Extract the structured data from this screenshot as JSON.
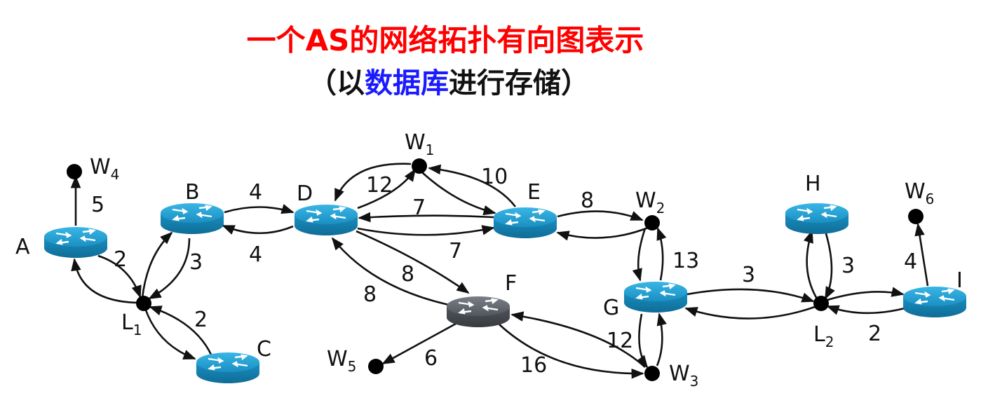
{
  "title": {
    "line1": "一个AS的网络拓扑有向图表示",
    "line2_prefix": "（以",
    "line2_highlight": "数据库",
    "line2_suffix": "进行存储）"
  },
  "colors": {
    "title": "#ff0000",
    "highlight": "#1a1aff",
    "router": "#1f9fd3",
    "router_gray": "#5b5f66"
  },
  "routers": [
    "A",
    "B",
    "D",
    "E",
    "F",
    "G",
    "H",
    "I"
  ],
  "hubs": [
    {
      "name": "L",
      "sub": "1"
    },
    {
      "name": "L",
      "sub": "2"
    },
    {
      "name": "C",
      "sub": ""
    }
  ],
  "hosts": [
    {
      "name": "W",
      "sub": "1"
    },
    {
      "name": "W",
      "sub": "2"
    },
    {
      "name": "W",
      "sub": "3"
    },
    {
      "name": "W",
      "sub": "4"
    },
    {
      "name": "W",
      "sub": "5"
    },
    {
      "name": "W",
      "sub": "6"
    }
  ],
  "edges": [
    {
      "from": "A",
      "to": "W4",
      "weight": "5"
    },
    {
      "from": "A",
      "to": "L1",
      "weight": "2"
    },
    {
      "from": "L1",
      "to": "A",
      "weight": ""
    },
    {
      "from": "B",
      "to": "L1",
      "weight": "3"
    },
    {
      "from": "L1",
      "to": "B",
      "weight": ""
    },
    {
      "from": "C",
      "to": "L1",
      "weight": "2"
    },
    {
      "from": "L1",
      "to": "C",
      "weight": ""
    },
    {
      "from": "B",
      "to": "D",
      "weight": "4"
    },
    {
      "from": "D",
      "to": "B",
      "weight": "4"
    },
    {
      "from": "D",
      "to": "W1",
      "weight": "12"
    },
    {
      "from": "W1",
      "to": "D",
      "weight": ""
    },
    {
      "from": "E",
      "to": "W1",
      "weight": "10"
    },
    {
      "from": "W1",
      "to": "E",
      "weight": ""
    },
    {
      "from": "E",
      "to": "D",
      "weight": "7"
    },
    {
      "from": "D",
      "to": "E",
      "weight": "7"
    },
    {
      "from": "E",
      "to": "W2",
      "weight": "8"
    },
    {
      "from": "W2",
      "to": "E",
      "weight": ""
    },
    {
      "from": "D",
      "to": "F",
      "weight": "8"
    },
    {
      "from": "F",
      "to": "D",
      "weight": "8"
    },
    {
      "from": "F",
      "to": "W5",
      "weight": "6"
    },
    {
      "from": "F",
      "to": "W3",
      "weight": "16"
    },
    {
      "from": "W3",
      "to": "F",
      "weight": ""
    },
    {
      "from": "W2",
      "to": "G",
      "weight": "13"
    },
    {
      "from": "G",
      "to": "W2",
      "weight": ""
    },
    {
      "from": "G",
      "to": "W3",
      "weight": "12"
    },
    {
      "from": "W3",
      "to": "G",
      "weight": ""
    },
    {
      "from": "G",
      "to": "L2",
      "weight": "3"
    },
    {
      "from": "L2",
      "to": "G",
      "weight": ""
    },
    {
      "from": "H",
      "to": "L2",
      "weight": "3"
    },
    {
      "from": "L2",
      "to": "H",
      "weight": ""
    },
    {
      "from": "I",
      "to": "L2",
      "weight": "2"
    },
    {
      "from": "L2",
      "to": "I",
      "weight": ""
    },
    {
      "from": "I",
      "to": "W6",
      "weight": "4"
    }
  ]
}
